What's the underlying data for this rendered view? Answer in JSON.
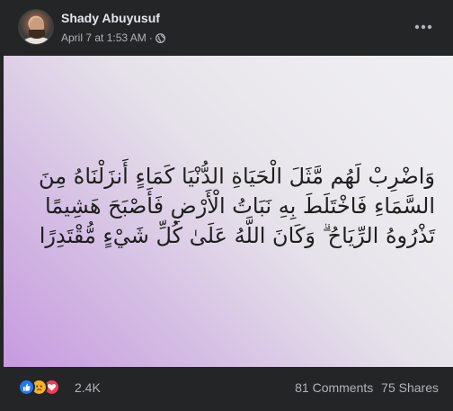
{
  "post": {
    "author": "Shady Abuyusuf",
    "timestamp": "April 7 at 1:53 AM",
    "separator": "·",
    "privacy_icon": "globe-icon",
    "more_icon": "more-horizontal-icon"
  },
  "media": {
    "verse_lines": [
      "وَاضْرِبْ لَهُم مَّثَلَ الْحَيَاةِ الدُّنْيَا كَمَاءٍ أَنزَلْنَاهُ مِنَ",
      "السَّمَاءِ فَاخْتَلَطَ بِهِ نَبَاتُ الْأَرْضِ فَأَصْبَحَ هَشِيمًا",
      "تَذْرُوهُ الرِّيَاحُ ۗ وَكَانَ اللَّهُ عَلَىٰ كُلِّ شَيْءٍ مُّقْتَدِرًا"
    ],
    "gradient_colors": [
      "#c79ae0",
      "#efeff2"
    ]
  },
  "footer": {
    "reactions": [
      "like-icon",
      "sad-icon",
      "love-icon"
    ],
    "reaction_count": "2.4K",
    "comments": "81 Comments",
    "shares": "75 Shares"
  },
  "colors": {
    "background": "#242526",
    "like": "#2078f4",
    "sad": "#f7b125",
    "love": "#f33e58"
  }
}
